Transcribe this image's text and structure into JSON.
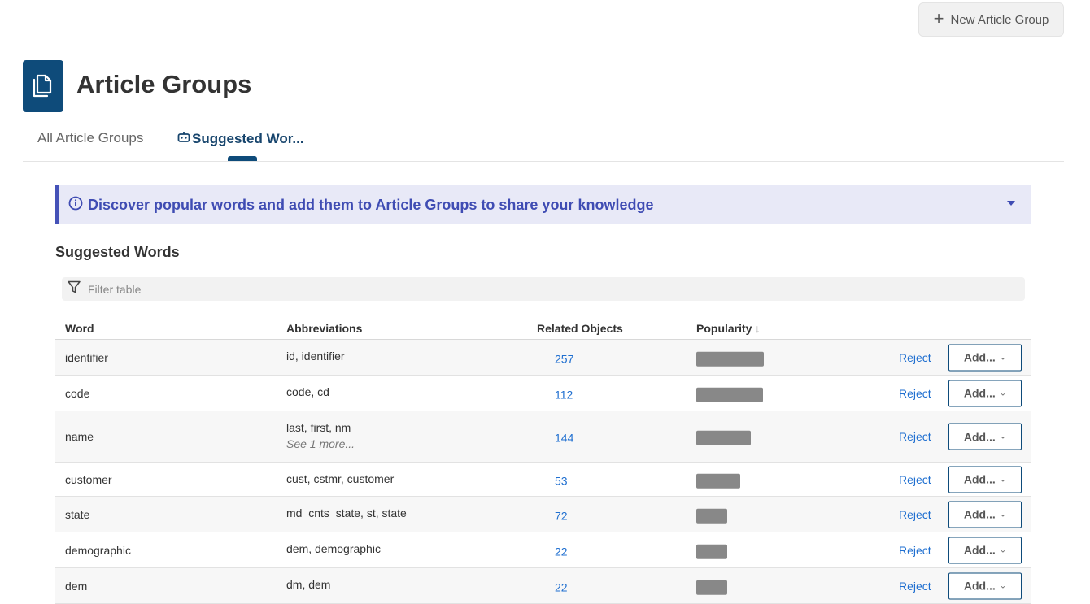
{
  "header": {
    "new_group_label": "New Article Group",
    "page_title": "Article Groups"
  },
  "tabs": [
    {
      "label": "All Article Groups",
      "active": false
    },
    {
      "label": "Suggested Wor...",
      "active": true
    }
  ],
  "banner": {
    "text": "Discover popular words and add them to Article Groups to share your knowledge"
  },
  "section_title": "Suggested Words",
  "filter": {
    "placeholder": "Filter table"
  },
  "table": {
    "columns": {
      "word": "Word",
      "abbreviations": "Abbreviations",
      "related": "Related Objects",
      "popularity": "Popularity",
      "popularity_sort": "↓"
    },
    "reject_label": "Reject",
    "add_label": "Add...",
    "rows": [
      {
        "word": "identifier",
        "abbreviations": "id, identifier",
        "see_more": "",
        "related": "257",
        "popularity": 0.83
      },
      {
        "word": "code",
        "abbreviations": "code, cd",
        "see_more": "",
        "related": "112",
        "popularity": 0.82
      },
      {
        "word": "name",
        "abbreviations": "last, first, nm",
        "see_more": "See 1 more...",
        "related": "144",
        "popularity": 0.67
      },
      {
        "word": "customer",
        "abbreviations": "cust, cstmr, customer",
        "see_more": "",
        "related": "53",
        "popularity": 0.54
      },
      {
        "word": "state",
        "abbreviations": "md_cnts_state, st, state",
        "see_more": "",
        "related": "72",
        "popularity": 0.38
      },
      {
        "word": "demographic",
        "abbreviations": "dem, demographic",
        "see_more": "",
        "related": "22",
        "popularity": 0.38
      },
      {
        "word": "dem",
        "abbreviations": "dm, dem",
        "see_more": "",
        "related": "22",
        "popularity": 0.38
      }
    ]
  },
  "colors": {
    "brand": "#0e4b7a",
    "banner_bg": "#e8e9f7",
    "banner_text": "#3f4cb3",
    "link": "#1f6fd0",
    "bar": "#888888"
  }
}
